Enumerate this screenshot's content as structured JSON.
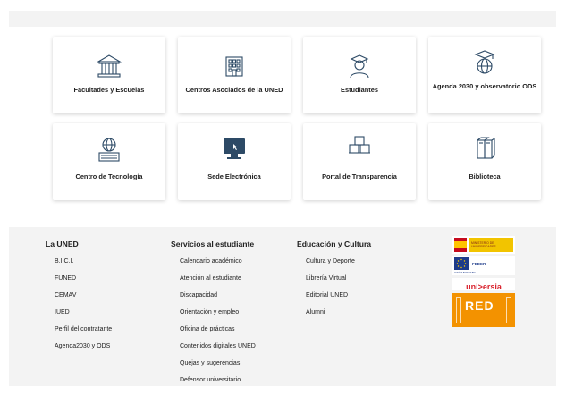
{
  "cards": [
    {
      "label": "Facultades y Escuelas",
      "icon": "university-building-icon"
    },
    {
      "label": "Centros Asociados de la UNED",
      "icon": "office-building-icon"
    },
    {
      "label": "Estudiantes",
      "icon": "graduate-student-icon"
    },
    {
      "label": "Agenda 2030 y observatorio ODS",
      "icon": "globe-graduation-cap-icon"
    },
    {
      "label": "Centro de Tecnología",
      "icon": "computer-globe-icon"
    },
    {
      "label": "Sede Electrónica",
      "icon": "monitor-cursor-icon"
    },
    {
      "label": "Portal de Transparencia",
      "icon": "stacked-boxes-icon"
    },
    {
      "label": "Biblioteca",
      "icon": "books-icon"
    }
  ],
  "footer": {
    "columns": [
      {
        "title": "La UNED",
        "items": [
          "B.I.C.I.",
          "FUNED",
          "CEMAV",
          "IUED",
          "Perfil del contratante",
          "Agenda2030 y ODS"
        ]
      },
      {
        "title": "Servicios al estudiante",
        "items": [
          "Calendario académico",
          "Atención al estudiante",
          "Discapacidad",
          "Orientación y empleo",
          "Oficina de prácticas",
          "Contenidos digitales UNED",
          "Quejas y sugerencias",
          "Defensor universitario"
        ]
      },
      {
        "title": "Educación y Cultura",
        "items": [
          "Cultura y Deporte",
          "Librería Virtual",
          "Editorial UNED",
          "Alumni"
        ]
      }
    ],
    "logos": {
      "ministerio": "MINISTERIO DE UNIVERSIDADES",
      "feder": "FEDER",
      "feder_small": "UNIÓN EUROPEA",
      "universia": "uni>ersia",
      "red": "RED"
    }
  },
  "colors": {
    "icon": "#2d4a66",
    "accent": "#d9232e",
    "orange": "#f39200"
  }
}
